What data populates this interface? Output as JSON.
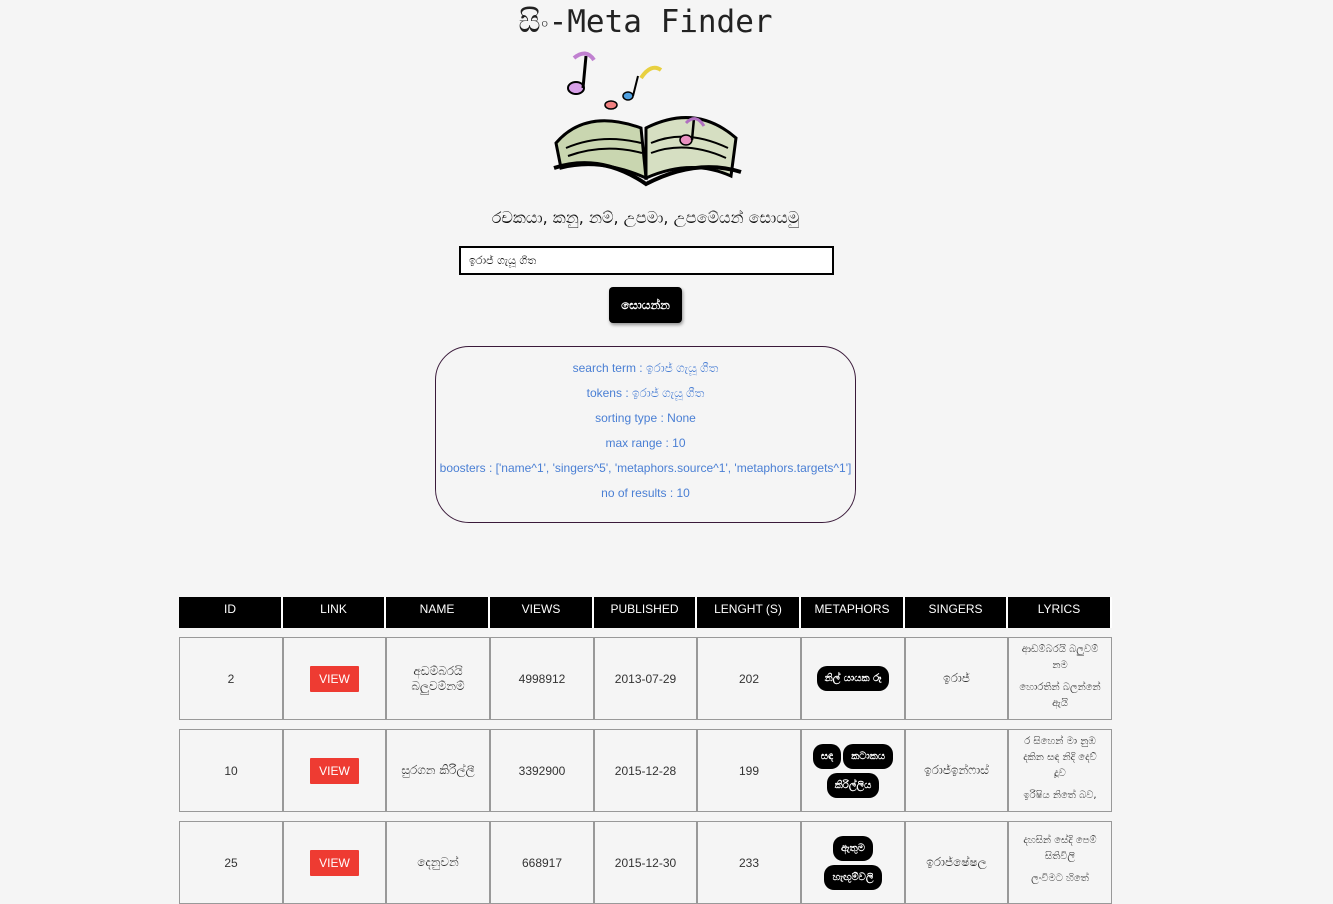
{
  "app": {
    "title": "සිං-Meta Finder",
    "subtitle": "රචකයා, කනු, නම්, උපමා, උපමේයන් සොයමු"
  },
  "search": {
    "value": "ඉරාජ් ගැයූ ගීත",
    "button_label": "සොයන්න"
  },
  "info": {
    "search_term": "search term : ඉරාජ් ගැයූ ගීත",
    "tokens": "tokens : ඉරාජ් ගැයූ ගීත",
    "sorting_type": "sorting type : None",
    "max_range": "max range : 10",
    "boosters": "boosters : ['name^1', 'singers^5', 'metaphors.source^1', 'metaphors.targets^1']",
    "no_of_results": "no of results : 10"
  },
  "table": {
    "headers": [
      "ID",
      "LINK",
      "NAME",
      "VIEWS",
      "PUBLISHED",
      "LENGHT (S)",
      "METAPHORS",
      "SINGERS",
      "LYRICS"
    ],
    "rows": [
      {
        "id": "2",
        "link": "VIEW",
        "name": "අඩම්බරයි බලුවම්නම්",
        "views": "4998912",
        "published": "2013-07-29",
        "length": "202",
        "metaphors": [
          "නිල් යායක රූ"
        ],
        "singers": "ඉරාජ්",
        "lyrics": [
          "ආඩම්බරයි බලුවම් නම",
          "හොරතින් බලන්නේ ඇයි"
        ]
      },
      {
        "id": "10",
        "link": "VIEW",
        "name": "සුරගන කිරිල්ලී",
        "views": "3392900",
        "published": "2015-12-28",
        "length": "199",
        "metaphors": [
          "සඳ",
          "කටාකය",
          "කිරිල්ලිය"
        ],
        "singers": "ඉරාජ්ඉන්ෆාස්",
        "lyrics": [
          "ර සිහෙන් මා නුඹ දකින සඳ නිදි දෙව් දූව",
          "ඉරිෂිය නිතේ බව,"
        ]
      },
      {
        "id": "25",
        "link": "VIEW",
        "name": "දෙනුවන්",
        "views": "668917",
        "published": "2015-12-30",
        "length": "233",
        "metaphors": [
          "ඇතුම",
          "හැඟුම්වලි"
        ],
        "singers": "ඉරාජ්ෂේෂල",
        "lyrics": [
          "දහසින් සේදි පෙම් සිතිවිලි",
          "ලංවිමට හිතේ"
        ]
      }
    ]
  },
  "colors": {
    "background": "#f5f5f5",
    "info_text": "#4a7fd4",
    "view_button": "#ee3b32",
    "header_bg": "#000000"
  },
  "icons": {
    "logo": "music-book-logo-icon"
  }
}
